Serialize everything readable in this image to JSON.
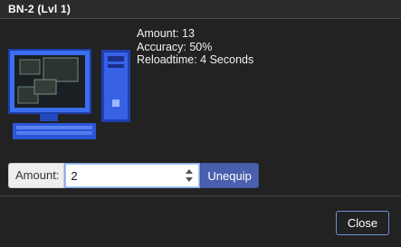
{
  "dialog": {
    "title": "BN-2 (Lvl 1)"
  },
  "item": {
    "image_icon": "computer-tower-pixel-icon",
    "stats": {
      "amount": "Amount: 13",
      "accuracy": "Accuracy: 50%",
      "reload": "Reloadtime: 4 Seconds"
    }
  },
  "form": {
    "amount_label": "Amount:",
    "amount_value": "2",
    "unequip_label": "Unequip"
  },
  "footer": {
    "close_label": "Close"
  },
  "colors": {
    "background": "#222222",
    "primary_button": "#4a5fae",
    "close_border": "#6e8fd8",
    "monitor_blue": "#2f5fe0"
  }
}
